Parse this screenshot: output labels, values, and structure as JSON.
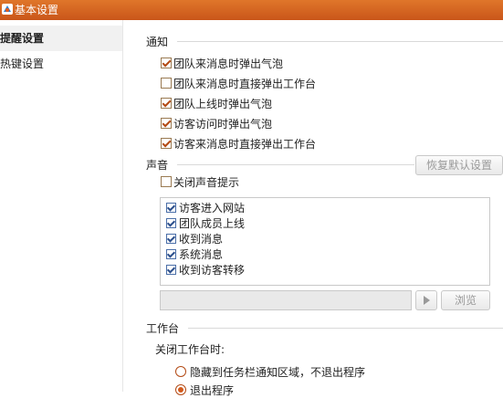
{
  "window": {
    "title": "基本设置"
  },
  "sidebar": {
    "items": [
      {
        "label": "提醒设置",
        "active": true
      },
      {
        "label": "热键设置",
        "active": false
      }
    ]
  },
  "notify": {
    "title": "通知",
    "options": [
      {
        "label": "团队来消息时弹出气泡",
        "checked": true
      },
      {
        "label": "团队来消息时直接弹出工作台",
        "checked": false
      },
      {
        "label": "团队上线时弹出气泡",
        "checked": true
      },
      {
        "label": "访客访问时弹出气泡",
        "checked": true
      },
      {
        "label": "访客来消息时直接弹出工作台",
        "checked": true
      }
    ]
  },
  "sound": {
    "title": "声音",
    "restore_label": "恢复默认设置",
    "mute_label": "关闭声音提示",
    "mute_checked": false,
    "events": [
      {
        "label": "访客进入网站",
        "checked": true
      },
      {
        "label": "团队成员上线",
        "checked": true
      },
      {
        "label": "收到消息",
        "checked": true
      },
      {
        "label": "系统消息",
        "checked": true
      },
      {
        "label": "收到访客转移",
        "checked": true
      }
    ],
    "path_value": "",
    "play_icon": "play-icon",
    "browse_label": "浏览"
  },
  "workbench": {
    "title": "工作台",
    "close_label": "关闭工作台时:",
    "options": [
      {
        "label": "隐藏到任务栏通知区域，不退出程序",
        "selected": false
      },
      {
        "label": "退出程序",
        "selected": true
      }
    ]
  },
  "colors": {
    "titlebar": "#d3601f",
    "accent": "#b34a14"
  }
}
